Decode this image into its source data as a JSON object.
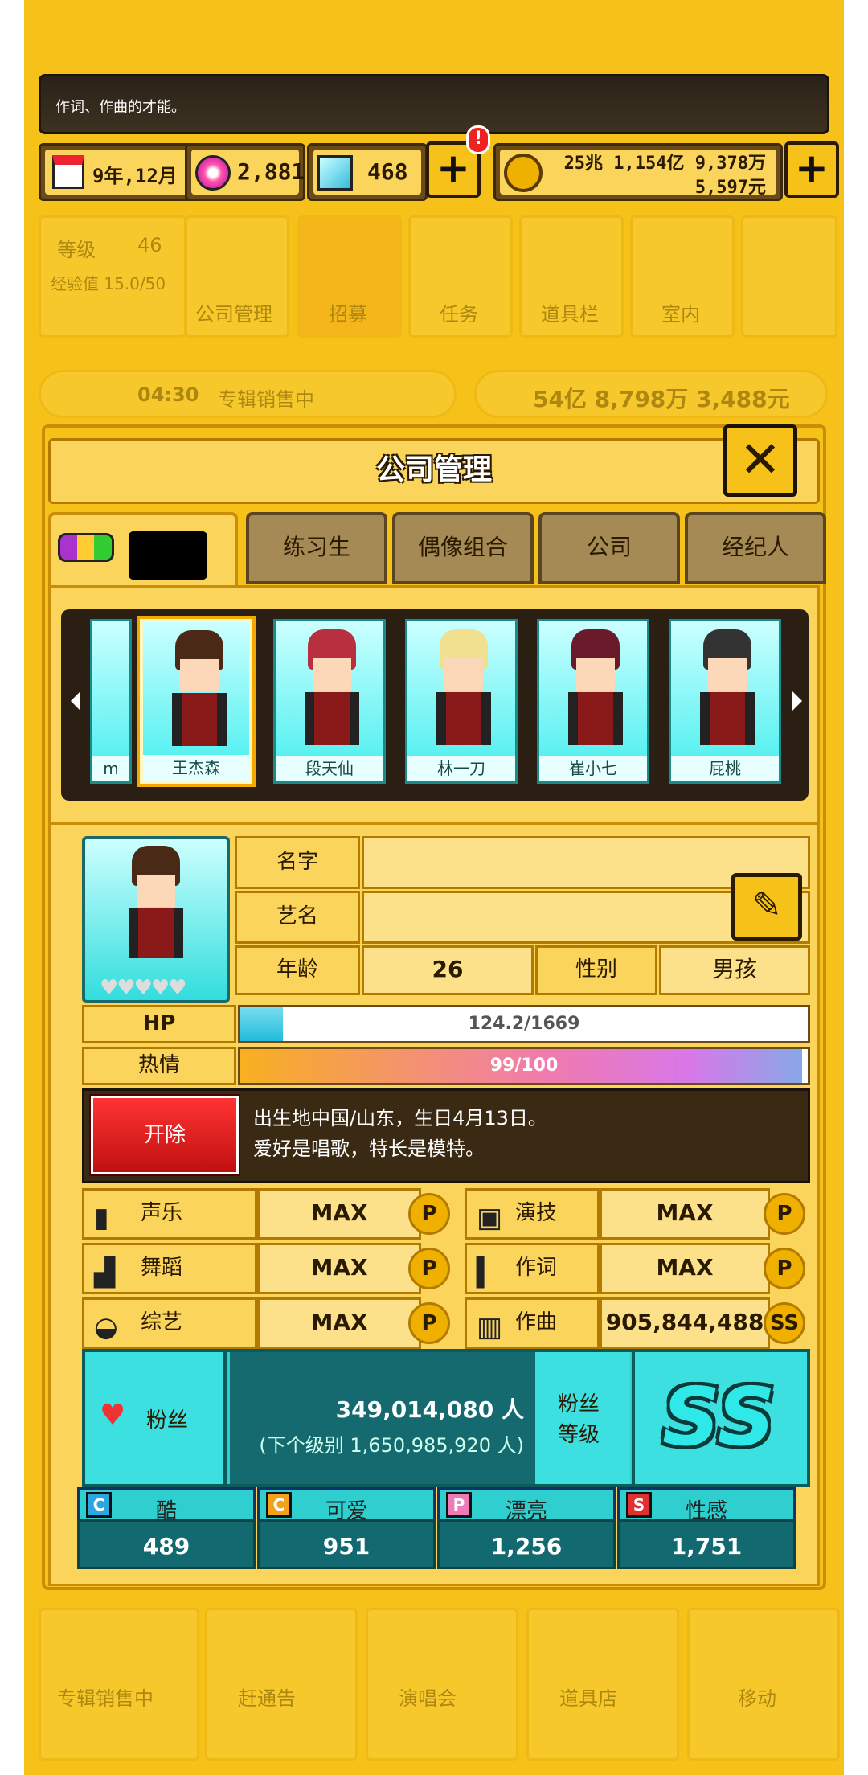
{
  "message": {
    "text": "作词、作曲的才能。"
  },
  "resources": {
    "date": "9年,12月",
    "gems": "2,881",
    "diamonds": "468",
    "money_top": "25兆 1,154亿 9,378万",
    "money_bottom": "5,597元",
    "alert": "!"
  },
  "background": {
    "level_label": "等级",
    "level_value": "46",
    "exp_label": "经验值 15.0/50",
    "menu": [
      "公司管理",
      "招募",
      "任务",
      "道具栏",
      "室内",
      ""
    ],
    "album_timer": "04:30",
    "album_status": "专辑销售中",
    "album_income": "54亿 8,798万 3,488元",
    "bottom_menu": [
      "专辑销售中",
      "赶通告",
      "演唱会",
      "道具店",
      "移动"
    ]
  },
  "dialog": {
    "title": "公司管理",
    "close": "✕",
    "tabs": [
      "练习生",
      "偶像组合",
      "公司",
      "经纪人"
    ]
  },
  "carousel": {
    "partial_name": "m",
    "members": [
      "王杰森",
      "段天仙",
      "林一刀",
      "崔小七",
      "屁桃"
    ]
  },
  "profile": {
    "name_label": "名字",
    "stage_label": "艺名",
    "age_label": "年龄",
    "age": "26",
    "gender_label": "性别",
    "gender": "男孩",
    "hp_label": "HP",
    "hp_text": "124.2/1669",
    "hp_fraction": 0.0744,
    "passion_label": "热情",
    "passion_text": "99/100",
    "passion_fraction": 0.99,
    "fire_button": "开除",
    "bio_line1": "出生地中国/山东，生日4月13日。",
    "bio_line2": "爱好是唱歌，特长是模特。"
  },
  "skills": [
    {
      "label": "声乐",
      "value": "MAX",
      "grade": "P"
    },
    {
      "label": "演技",
      "value": "MAX",
      "grade": "P"
    },
    {
      "label": "舞蹈",
      "value": "MAX",
      "grade": "P"
    },
    {
      "label": "作词",
      "value": "MAX",
      "grade": "P"
    },
    {
      "label": "综艺",
      "value": "MAX",
      "grade": "P"
    },
    {
      "label": "作曲",
      "value": "905,844,488",
      "grade": "SS"
    }
  ],
  "fans": {
    "label": "粉丝",
    "count": "349,014,080 人",
    "next": "(下个级别 1,650,985,920 人)",
    "level_label_1": "粉丝",
    "level_label_2": "等级",
    "level": "SS"
  },
  "traits": [
    {
      "icon": "C",
      "label": "酷",
      "value": "489",
      "color": "#2aa6e0"
    },
    {
      "icon": "C",
      "label": "可爱",
      "value": "951",
      "color": "#f2a21a"
    },
    {
      "icon": "P",
      "label": "漂亮",
      "value": "1,256",
      "color": "#f07ab8"
    },
    {
      "icon": "S",
      "label": "性感",
      "value": "1,751",
      "color": "#e03030"
    }
  ]
}
